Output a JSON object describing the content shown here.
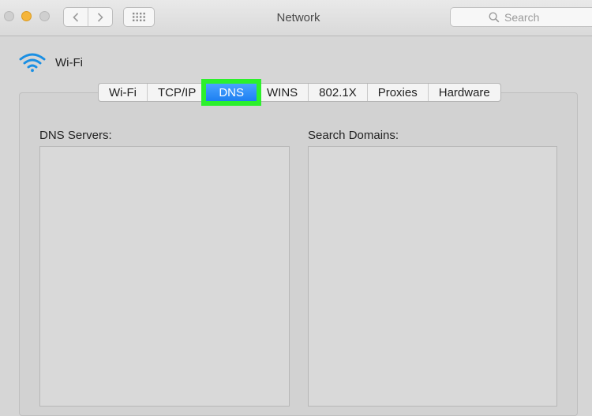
{
  "window": {
    "title": "Network",
    "search_placeholder": "Search"
  },
  "interface": {
    "name": "Wi-Fi",
    "icon": "wifi-icon"
  },
  "tabs": [
    {
      "label": "Wi-Fi",
      "selected": false
    },
    {
      "label": "TCP/IP",
      "selected": false
    },
    {
      "label": "DNS",
      "selected": true
    },
    {
      "label": "WINS",
      "selected": false
    },
    {
      "label": "802.1X",
      "selected": false
    },
    {
      "label": "Proxies",
      "selected": false
    },
    {
      "label": "Hardware",
      "selected": false
    }
  ],
  "dns": {
    "servers_label": "DNS Servers:",
    "domains_label": "Search Domains:",
    "servers": [],
    "domains": []
  },
  "colors": {
    "accent": "#1d7ff2",
    "highlight": "#2cf02c",
    "wifi": "#1a8fe3"
  }
}
